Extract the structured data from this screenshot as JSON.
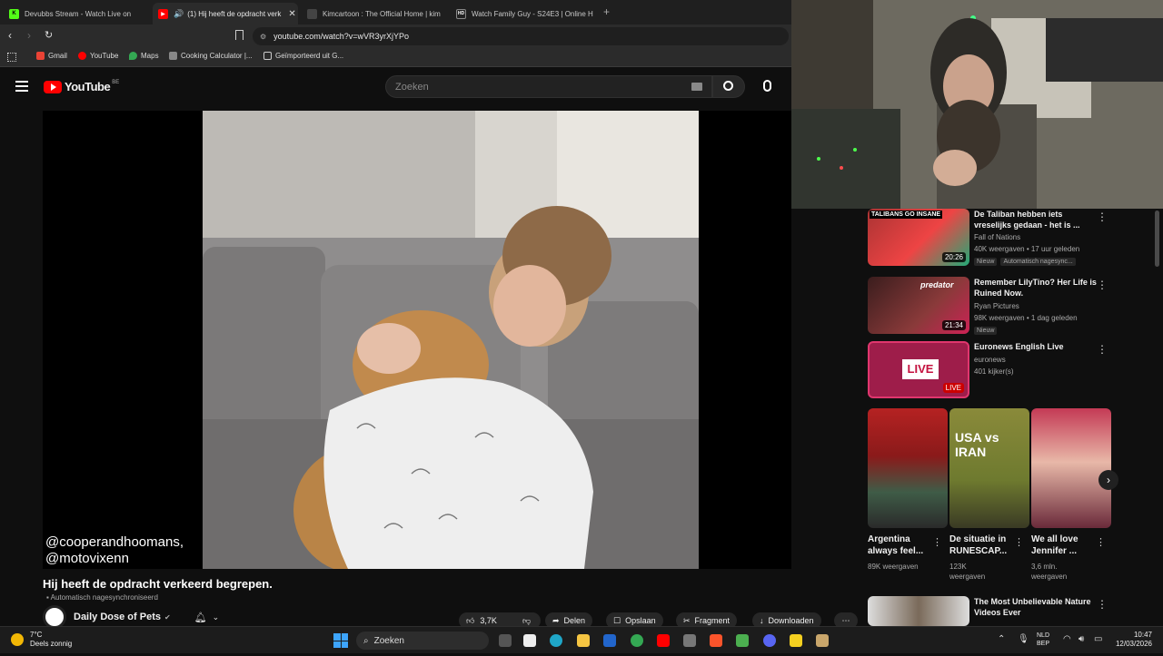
{
  "browser": {
    "tabs": [
      {
        "label": "Devubbs Stream - Watch Live on",
        "icon": "kick-icon",
        "color": "#53fc18"
      },
      {
        "label": "(1) Hij heeft de opdracht verk",
        "icon": "youtube-icon",
        "color": "#ff0000"
      },
      {
        "label": "Kimcartoon : The Official Home | kim",
        "icon": "kimcartoon-icon",
        "color": "#555555"
      },
      {
        "label": "Watch Family Guy - S24E3 | Online H",
        "icon": "hd-icon",
        "color": "#333333"
      }
    ],
    "url": "youtube.com/watch?v=wVR3yrXjYPo",
    "bookmarks": [
      "Gmail",
      "YouTube",
      "Maps",
      "Cooking Calculator |...",
      "Geïmporteerd uit G..."
    ]
  },
  "youtube": {
    "logo_text": "YouTube",
    "region": "BE",
    "search_placeholder": "Zoeken",
    "video": {
      "caption_line1": "@cooperandhoomans,",
      "caption_line2": "@motovixenn",
      "title": "Hij heeft de opdracht verkeerd begrepen.",
      "dub_note": "Automatisch nagesynchroniseerd",
      "channel": "Daily Dose of Pets"
    },
    "actions": {
      "likes": "3,7K",
      "share": "Delen",
      "save": "Opslaan",
      "clip": "Fragment",
      "download": "Downloaden"
    },
    "sidebar": [
      {
        "title": "De Taliban hebben iets vreselijks gedaan - het is ...",
        "channel": "Fall of Nations",
        "meta": "40K weergaven • 17 uur geleden",
        "badge": "Nieuw",
        "extra": "Automatisch nagesync...",
        "duration": "20:26",
        "thumb_text": "TALIBANS GO INSANE"
      },
      {
        "title": "Remember LilyTino? Her Life is Ruined Now.",
        "channel": "Ryan Pictures",
        "meta": "98K weergaven • 1 dag geleden",
        "badge": "Nieuw",
        "duration": "21:34",
        "thumb_text": "predator"
      },
      {
        "title": "Euronews English Live",
        "channel": "euronews",
        "meta": "401 kijker(s)",
        "duration": "LIVE",
        "thumb_text": "LIVE"
      },
      {
        "title": "The Most Unbelievable Nature Videos Ever"
      }
    ],
    "shorts": [
      {
        "title": "Argentina always feel...",
        "meta": "89K weergaven"
      },
      {
        "title": "De situatie in RUNESCAP...",
        "meta": "123K weergaven",
        "thumb_text": "USA vs IRAN"
      },
      {
        "title": "We all love Jennifer ...",
        "meta": "3,6 mln. weergaven"
      }
    ]
  },
  "taskbar": {
    "weather_temp": "7°C",
    "weather_desc": "Deels zonnig",
    "search": "Zoeken",
    "lang1": "NLD",
    "lang2": "BEP",
    "time": "10:47",
    "date": "12/03/2026"
  }
}
